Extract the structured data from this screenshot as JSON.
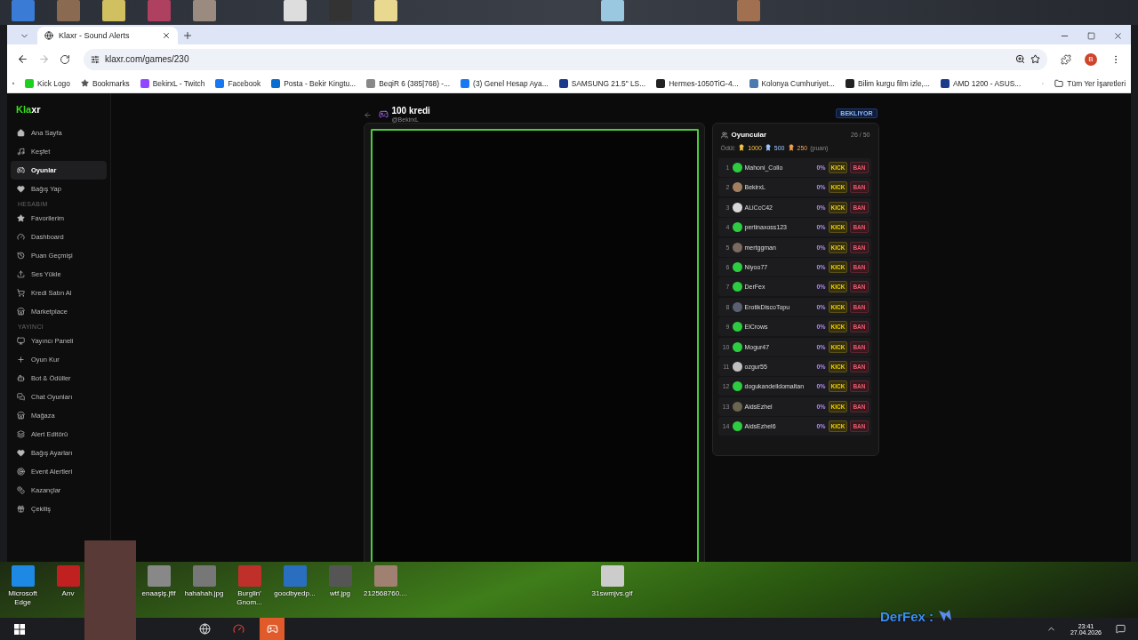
{
  "browser": {
    "tab": {
      "title": "Klaxr - Sound Alerts",
      "selected": true
    },
    "url": "klaxr.com/games/230",
    "profile_initial": "B",
    "bookmarks": [
      "Kick Logo",
      "Bookmarks",
      "BekirxL - Twitch",
      "Facebook",
      "Posta - Bekir Kingtu...",
      "BeqiR 6 (385|768) -...",
      "(3) Genel Hesap Aya...",
      "SAMSUNG 21.5\" LS...",
      "Hermes-1050TiG-4...",
      "Kolonya Cumhuriyet...",
      "Bilim kurgu film izle,...",
      "AMD 1200 - ASUS..."
    ],
    "all_bookmarks": "Tüm Yer İşaretleri"
  },
  "sidebar": {
    "logo": {
      "accent": "Kla",
      "rest": "xr"
    },
    "sections": [
      {
        "items": [
          {
            "label": "Ana Sayfa",
            "selected": false
          },
          {
            "label": "Keşfet",
            "selected": false
          },
          {
            "label": "Oyunlar",
            "selected": true
          },
          {
            "label": "Bağış Yap",
            "selected": false
          }
        ]
      },
      {
        "title": "HESABIM",
        "items": [
          {
            "label": "Favorilerim",
            "selected": false
          },
          {
            "label": "Dashboard",
            "selected": false
          },
          {
            "label": "Puan Geçmişi",
            "selected": false
          },
          {
            "label": "Ses Yükle",
            "selected": false
          },
          {
            "label": "Kredi Satın Al",
            "selected": false
          },
          {
            "label": "Marketplace",
            "selected": false
          }
        ]
      },
      {
        "title": "YAYINCI",
        "items": [
          {
            "label": "Yayıncı Paneli",
            "selected": false
          },
          {
            "label": "Oyun Kur",
            "selected": false
          },
          {
            "label": "Bot & Ödüller",
            "selected": false
          },
          {
            "label": "Chat Oyunları",
            "selected": false
          },
          {
            "label": "Mağaza",
            "selected": false
          },
          {
            "label": "Alert Editörü",
            "selected": false
          },
          {
            "label": "Bağış Ayarları",
            "selected": false
          },
          {
            "label": "Event Alertleri",
            "selected": false
          },
          {
            "label": "Kazançlar",
            "selected": false
          },
          {
            "label": "Çekiliş",
            "selected": false
          }
        ]
      }
    ]
  },
  "game": {
    "title": "100 kredi",
    "host": "@BekirxL",
    "status": "BEKLIYOR"
  },
  "players_panel": {
    "title": "Oyuncular",
    "count": "26 / 50",
    "prize_label": "Ödül:",
    "prizes": [
      {
        "value": "1000",
        "color": "#f5c542"
      },
      {
        "value": "500",
        "color": "#9ec9ff"
      },
      {
        "value": "250",
        "color": "#f0a050"
      }
    ],
    "prize_unit": "(puan)",
    "players": [
      {
        "rank": "1",
        "name": "Mahoni_Collo",
        "percent": "0%",
        "color": "#2ecc40",
        "actions": [
          "KICK",
          "BAN"
        ]
      },
      {
        "rank": "2",
        "name": "BekirxL",
        "percent": "0%",
        "color": "#a08060",
        "actions": [
          "KICK",
          "BAN"
        ]
      },
      {
        "rank": "3",
        "name": "ALiCcC42",
        "percent": "0%",
        "color": "#d8d8d8",
        "actions": [
          "KICK",
          "BAN"
        ]
      },
      {
        "rank": "4",
        "name": "pertinaxoss123",
        "percent": "0%",
        "color": "#2ecc40",
        "actions": [
          "KICK",
          "BAN"
        ]
      },
      {
        "rank": "5",
        "name": "mertggman",
        "percent": "0%",
        "color": "#7a6a60",
        "actions": [
          "KICK",
          "BAN"
        ]
      },
      {
        "rank": "6",
        "name": "Niyoo77",
        "percent": "0%",
        "color": "#2ecc40",
        "actions": [
          "KICK",
          "BAN"
        ]
      },
      {
        "rank": "7",
        "name": "DerFex",
        "percent": "0%",
        "color": "#2ecc40",
        "actions": [
          "KICK",
          "BAN"
        ]
      },
      {
        "rank": "8",
        "name": "ErotikDiscoTopu",
        "percent": "0%",
        "color": "#5a6070",
        "actions": [
          "KICK",
          "BAN"
        ]
      },
      {
        "rank": "9",
        "name": "ElCrows",
        "percent": "0%",
        "color": "#2ecc40",
        "actions": [
          "KICK",
          "BAN"
        ]
      },
      {
        "rank": "10",
        "name": "Mogur47",
        "percent": "0%",
        "color": "#2ecc40",
        "actions": [
          "KICK",
          "BAN"
        ]
      },
      {
        "rank": "11",
        "name": "ozgur55",
        "percent": "0%",
        "color": "#c0c0c0",
        "actions": [
          "KICK",
          "BAN"
        ]
      },
      {
        "rank": "12",
        "name": "dogukandeildomaltan",
        "percent": "0%",
        "color": "#2ecc40",
        "actions": [
          "KICK",
          "BAN"
        ]
      },
      {
        "rank": "13",
        "name": "AidsEzhel",
        "percent": "0%",
        "color": "#6b6450",
        "actions": [
          "KICK",
          "BAN"
        ]
      },
      {
        "rank": "14",
        "name": "AidsEzhel6",
        "percent": "0%",
        "color": "#2ecc40",
        "actions": [
          "KICK",
          "BAN"
        ]
      }
    ]
  },
  "desktop_icons": [
    "Microsoft Edge",
    "Anv",
    "enaaşiş.jfif",
    "hahahah.jpg",
    "Burglin' Gnom...",
    "goodbyedp...",
    "wtf.jpg",
    "212568760....",
    "31swmjvs.gif"
  ],
  "stream_overlay": "DerFex :",
  "taskbar": {
    "time": "23:41",
    "date": "27.04.2026"
  }
}
